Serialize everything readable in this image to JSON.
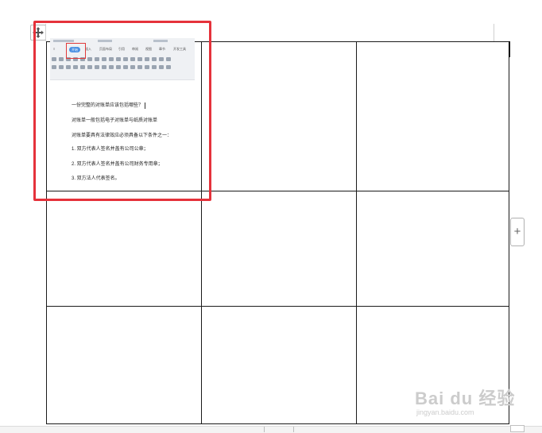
{
  "document": {
    "add_column_symbol": "+"
  },
  "embedded_screenshot": {
    "ribbon_tabs": [
      {
        "label": "开始",
        "active": true
      },
      {
        "label": "插入",
        "active": false
      },
      {
        "label": "页面布局",
        "active": false
      },
      {
        "label": "引用",
        "active": false
      },
      {
        "label": "审阅",
        "active": false
      },
      {
        "label": "视图",
        "active": false
      },
      {
        "label": "章节",
        "active": false
      },
      {
        "label": "开发工具",
        "active": false
      }
    ],
    "lines": [
      "一份完整的对账单应该包括哪些？",
      "对账单一般包括电子对账单与纸质对账单",
      "对账单要具有法律效应必须具备以下条件之一：",
      "1.  双方代表人签名并盖有公司公章；",
      "2.  双方代表人签名并盖有公司财务专用章；",
      "3.  双方法人代表签名。"
    ]
  },
  "watermark": {
    "main": "Bai du 经验",
    "sub": "jingyan.baidu.com"
  },
  "colors": {
    "highlight_frame": "#e5323b",
    "active_tab": "#4a90e2"
  }
}
